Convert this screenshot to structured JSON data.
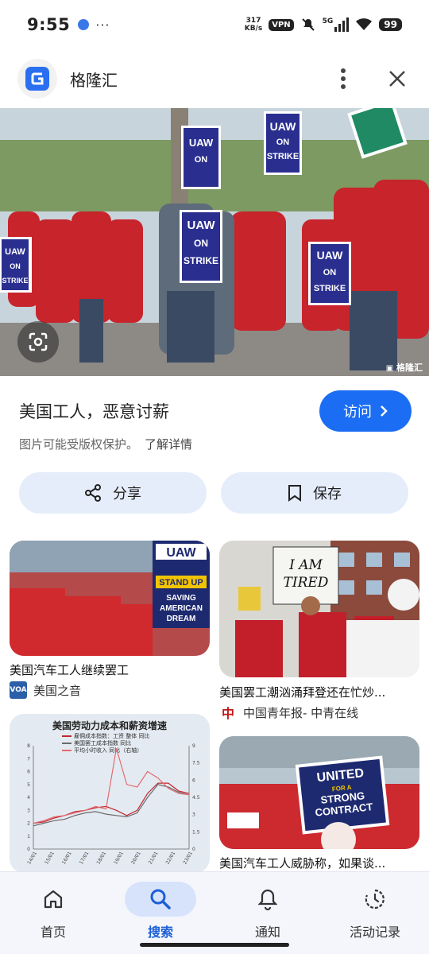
{
  "status_bar": {
    "time": "9:55",
    "more": "···",
    "net_speed_value": "317",
    "net_speed_unit": "KB/s",
    "vpn": "VPN",
    "network": "5G",
    "battery": "99"
  },
  "header": {
    "site_name": "格隆汇"
  },
  "hero": {
    "watermark": "格隆汇",
    "signs": [
      "UAW",
      "ON",
      "STRIKE"
    ]
  },
  "result": {
    "title": "美国工人，恶意讨薪",
    "visit_label": "访问",
    "copyright_notice": "图片可能受版权保护。",
    "learn_more": "了解详情"
  },
  "actions": {
    "share_label": "分享",
    "save_label": "保存"
  },
  "related": [
    {
      "caption": "美国汽车工人继续罢工",
      "source": "美国之音",
      "sign_text": "UAW",
      "sign_sub": "STAND UP",
      "sign_sub2": "SAVING AMERICAN DREAM"
    },
    {
      "caption": "美国罢工潮汹涌拜登还在忙炒...",
      "source": "中国青年报- 中青在线",
      "sign_text": "I AM TIRED"
    },
    {
      "caption": "",
      "source": "",
      "chart_title": "美国劳动力成本和薪资增速"
    },
    {
      "caption": "美国汽车工人威胁称，如果谈...",
      "source": "",
      "sign_text": "UNITED",
      "sign_sub": "FOR A",
      "sign_sub2": "STRONG CONTRACT"
    }
  ],
  "chart_data": {
    "type": "line",
    "title": "美国劳动力成本和薪资增速",
    "series": [
      {
        "name": "雇佣成本指数：工资 整体 同比",
        "values": [
          2.0,
          2.1,
          2.4,
          2.6,
          2.9,
          3.0,
          3.2,
          3.3,
          3.0,
          2.6,
          3.0,
          4.3,
          5.1,
          5.1,
          4.5,
          4.3
        ]
      },
      {
        "name": "美国罢工成本指数 同比",
        "values": [
          1.8,
          2.0,
          2.2,
          2.3,
          2.6,
          2.8,
          2.9,
          2.7,
          2.6,
          2.5,
          2.8,
          4.0,
          5.0,
          4.8,
          4.4,
          4.2
        ]
      },
      {
        "name": "平均小时收入 同比（右轴）",
        "values": [
          2.0,
          2.2,
          2.5,
          2.6,
          2.8,
          3.0,
          3.3,
          3.1,
          7.8,
          5.0,
          4.8,
          6.0,
          5.5,
          4.7,
          4.3,
          4.2
        ]
      }
    ],
    "x": [
      "14/01",
      "15/01",
      "16/01",
      "17/01",
      "18/01",
      "19/01",
      "20/01",
      "21/01",
      "22/01",
      "23/01"
    ],
    "yleft_ticks": [
      "0",
      "1",
      "2",
      "3",
      "4",
      "5",
      "6",
      "7",
      "8"
    ],
    "yright_ticks": [
      "0",
      "1.5",
      "3",
      "4.5",
      "6",
      "7.5",
      "9"
    ]
  },
  "bottom_nav": [
    {
      "label": "首页",
      "icon": "home-icon"
    },
    {
      "label": "搜索",
      "icon": "search-icon",
      "active": true
    },
    {
      "label": "通知",
      "icon": "bell-icon"
    },
    {
      "label": "活动记录",
      "icon": "history-icon"
    }
  ]
}
